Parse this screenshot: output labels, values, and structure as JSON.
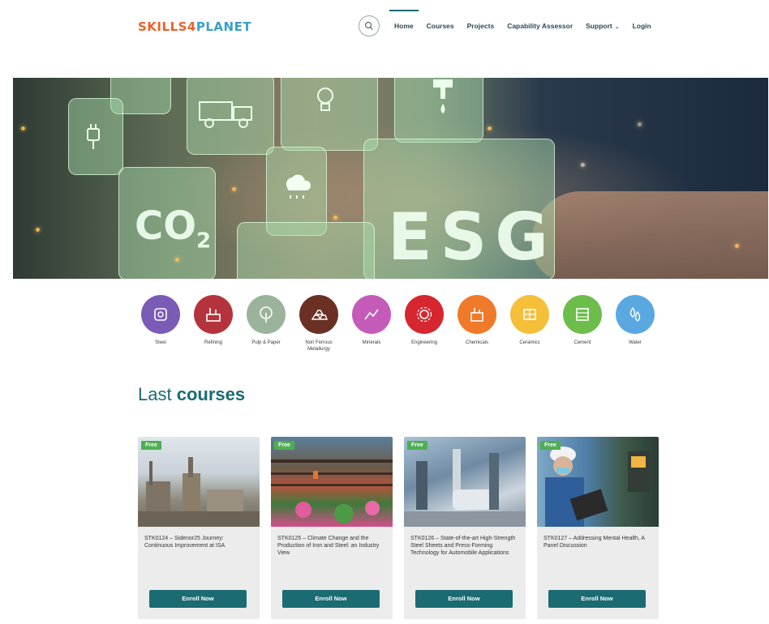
{
  "logo": {
    "text_a": "SKILLS4",
    "text_b": "PLANET"
  },
  "nav": {
    "items": [
      {
        "label": "Home"
      },
      {
        "label": "Courses"
      },
      {
        "label": "Projects"
      },
      {
        "label": "Capability Assessor"
      },
      {
        "label": "Support"
      },
      {
        "label": "Login"
      }
    ]
  },
  "hero": {
    "co2": "CO",
    "co2_sub": "2",
    "esg": "ESG"
  },
  "categories": [
    {
      "label": "Steel",
      "color": "#7a5bb5",
      "icon": "steel-icon"
    },
    {
      "label": "Refining",
      "color": "#b5333d",
      "icon": "refinery-icon"
    },
    {
      "label": "Pulp & Paper",
      "color": "#9ab39a",
      "icon": "tree-icon"
    },
    {
      "label": "Non Ferrous Metallurgy",
      "color": "#6b3024",
      "icon": "ingots-icon"
    },
    {
      "label": "Minerals",
      "color": "#c45bb8",
      "icon": "minerals-icon"
    },
    {
      "label": "Engineering",
      "color": "#d6262f",
      "icon": "gear-icon"
    },
    {
      "label": "Chemicals",
      "color": "#ef7a2a",
      "icon": "chemicals-icon"
    },
    {
      "label": "Ceramics",
      "color": "#f6bf3a",
      "icon": "ceramics-icon"
    },
    {
      "label": "Cement",
      "color": "#6dbd4b",
      "icon": "cement-icon"
    },
    {
      "label": "Water",
      "color": "#5aa8e0",
      "icon": "water-drops-icon"
    }
  ],
  "section": {
    "title_light": "Last ",
    "title_bold": "courses"
  },
  "courses": [
    {
      "badge": "Free",
      "title": "STK0124 – Sidenor25 Journey: Continuous Improvement at ISA",
      "button": "Enroll Now"
    },
    {
      "badge": "Free",
      "title": "STK0125 – Climate Change and the Production of Iron and Steel: an Industry View",
      "button": "Enroll Now"
    },
    {
      "badge": "Free",
      "title": "STK0126 – State-of-the-art High-Strength Steel Sheets and Press-Forming Technology for Automobile Applications",
      "button": "Enroll Now"
    },
    {
      "badge": "Free",
      "title": "STK0127 – Addressing Mental Health, A Panel Discussion",
      "button": "Enroll Now"
    }
  ]
}
